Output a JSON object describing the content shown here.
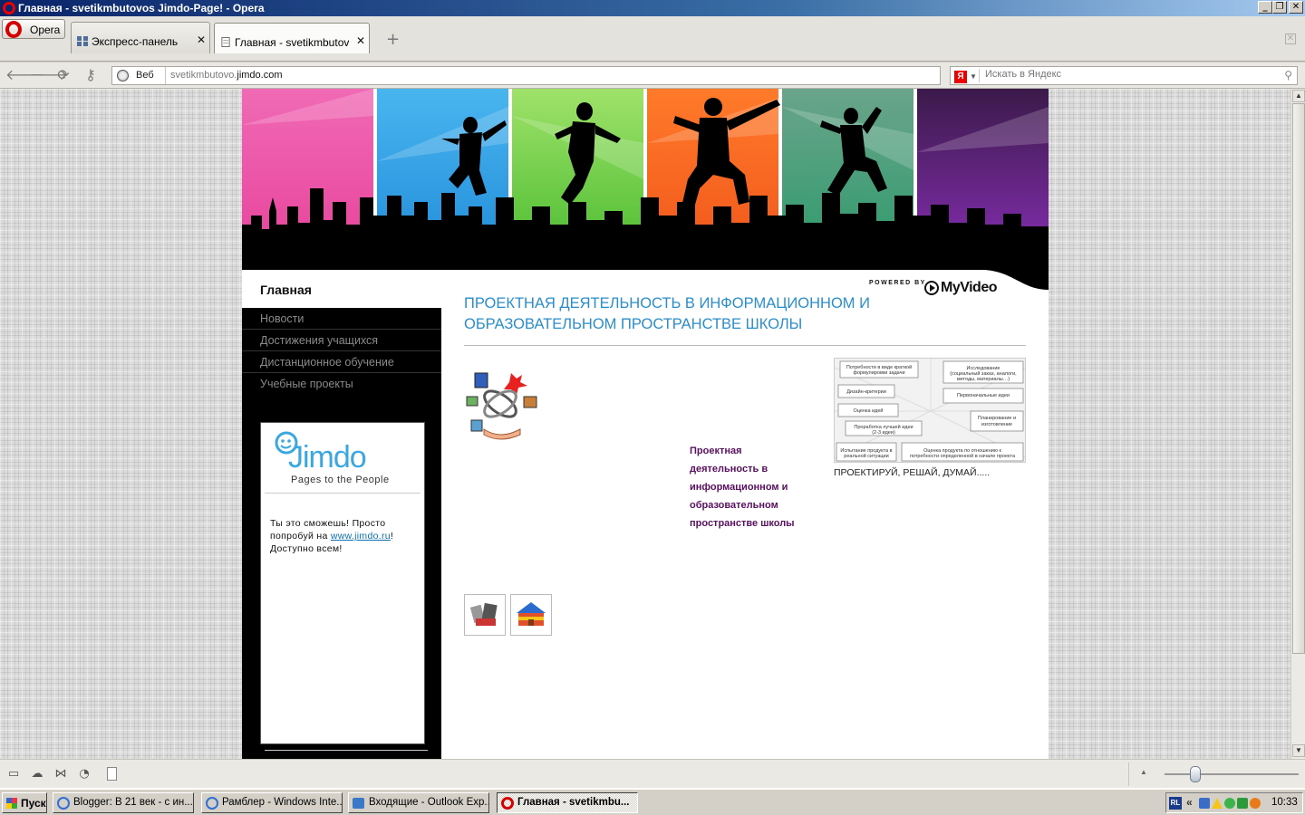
{
  "window": {
    "title": "Главная - svetikmbutovos Jimdo-Page! - Opera",
    "buttons": {
      "minimize": "_",
      "maximize": "❐",
      "close": "✕"
    }
  },
  "browser": {
    "opera_menu_label": "Opera",
    "tabs": [
      {
        "label": "Экспресс-панель",
        "icon": "speed-dial-icon",
        "active": false
      },
      {
        "label": "Главная - svetikmbutovo...",
        "icon": "page-icon",
        "active": true
      }
    ],
    "new_tab": "+",
    "address": {
      "mode_label": "Веб",
      "url_prefix": "svetikmbutovo.",
      "url_domain": "jimdo.com"
    },
    "search": {
      "engine_badge": "Я",
      "placeholder": "Искать в Яндекс"
    }
  },
  "site": {
    "header": {
      "stripe_colors": [
        "#e8479a",
        "#2b9be0",
        "#5cc93a",
        "#f26422",
        "#2f9a6f",
        "#7b2aa6"
      ],
      "powered_by": "POWERED BY",
      "brand": "MyVideo"
    },
    "nav": {
      "home": "Главная",
      "items": [
        "Новости",
        "Достижения учащихся",
        "Дистанционное обучение",
        "Учебные проекты"
      ]
    },
    "ad": {
      "logo_text": "Jimdo",
      "tagline": "Pages to the People",
      "text_before_link": "Ты это сможешь! Просто попробуй на ",
      "link_text": "www.jimdo.ru",
      "text_after_link": "! Доступно всем!"
    },
    "content": {
      "title": "ПРОЕКТНАЯ ДЕЯТЕЛЬНОСТЬ В ИНФОРМАЦИОННОМ И ОБРАЗОВАТЕЛЬНОМ ПРОСТРАНСТВЕ ШКОЛЫ",
      "project_text": "Проектная деятельность в информационном и образовательном пространстве школы",
      "diagram_caption": "ПРОЕКТИРУЙ, РЕШАЙ, ДУМАЙ.....",
      "diagram_boxes": [
        "1. Потребности в виде краткой формулировки задачи",
        "2. Исследование (социальный заказ, аналоги, методы, материалы…)",
        "3. Дизайн-критерии",
        "4. Первоначальные идеи (много)",
        "5. Оценка идей",
        "6. Проработка лучшей идеи (2-3 идеи)",
        "7. Планирование и изготовление",
        "8. Испытание продукта в реальной ситуации",
        "9. Оценка продукта по отношению к потребности определенной в начале проекта"
      ]
    }
  },
  "statusbar": {
    "zoom_level": 0.23
  },
  "taskbar": {
    "start_label": "Пуск",
    "tasks": [
      {
        "label": "Blogger: В 21 век - с ин...",
        "icon_color": "#2f6fd6",
        "active": false
      },
      {
        "label": "Рамблер - Windows Inte...",
        "icon_color": "#2f6fd6",
        "active": false
      },
      {
        "label": "Входящие - Outlook Exp...",
        "icon_color": "#3a78c8",
        "active": false
      },
      {
        "label": "Главная - svetikmbu...",
        "icon_color": "#d40000",
        "active": true
      }
    ],
    "tray": {
      "language": "RL",
      "chevron": "«",
      "time": "10:33"
    }
  }
}
